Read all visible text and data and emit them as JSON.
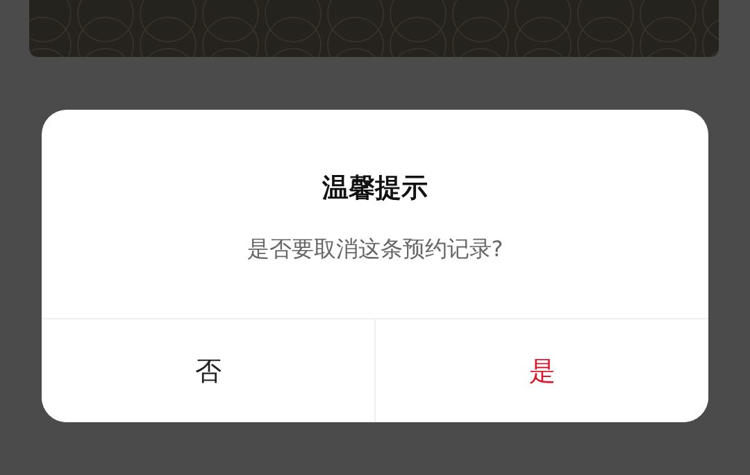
{
  "dialog": {
    "title": "温馨提示",
    "message": "是否要取消这条预约记录?",
    "buttons": [
      {
        "label": "否",
        "kind": "cancel"
      },
      {
        "label": "是",
        "kind": "confirm"
      }
    ]
  }
}
